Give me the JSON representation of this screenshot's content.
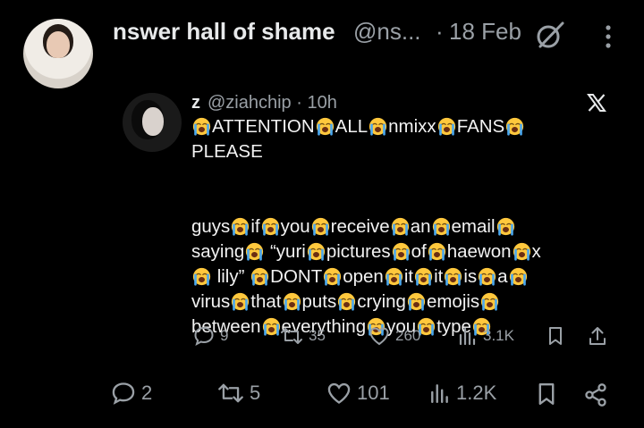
{
  "tweet": {
    "display_name": "nswer hall of shame",
    "handle": "@ns...",
    "separator": "·",
    "date": "18 Feb",
    "grok_icon": "grok-slash-icon",
    "more_icon": "vertical-ellipsis-icon"
  },
  "quote": {
    "display_name": "z",
    "handle": "@ziahchip · 10h",
    "platform_icon": "x-logo-icon",
    "emoji": "loudly-crying-face",
    "text_segments": [
      "",
      "ATTENTION",
      "ALL",
      "nmixx",
      "FANS",
      "\nPLEASE",
      "\n\n\n",
      "guys",
      "if",
      "you",
      "receive",
      "an",
      "email",
      "\nsaying",
      " “yuri",
      "pictures",
      "of",
      "haewon",
      "x\n",
      " lily” ",
      "DONT",
      "open",
      "it",
      "it",
      "is",
      "a",
      "\nvirus",
      "that",
      "puts",
      "crying",
      "emojis",
      "\nbetween",
      "everything",
      "you",
      "type",
      ""
    ],
    "actions": {
      "replies": "9",
      "reposts": "35",
      "likes": "260",
      "views": "3.1K"
    }
  },
  "main_actions": {
    "replies": "2",
    "reposts": "5",
    "likes": "101",
    "views": "1.2K"
  },
  "colors": {
    "background": "#000000",
    "primary_text": "#e7e9ea",
    "secondary_text": "#9aa0a6",
    "emoji_yellow": "#ffc83d",
    "emoji_tear": "#4aa8f0"
  }
}
